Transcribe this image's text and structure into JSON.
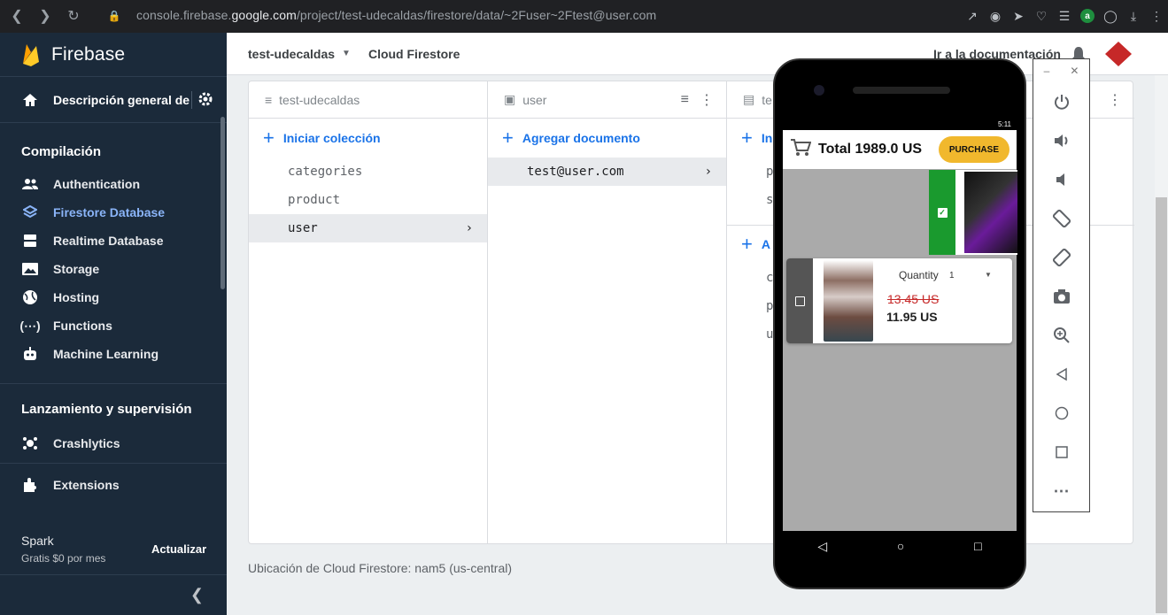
{
  "browser": {
    "url_prefix": "console.firebase.",
    "url_domain": "google.com",
    "url_path": "/project/test-udecaldas/firestore/data/~2Fuser~2Ftest@user.com"
  },
  "sidebar": {
    "brand": "Firebase",
    "overview": "Descripción general de",
    "section_build": "Compilación",
    "items": [
      {
        "label": "Authentication",
        "icon": "people-icon"
      },
      {
        "label": "Firestore Database",
        "icon": "firestore-icon"
      },
      {
        "label": "Realtime Database",
        "icon": "database-icon"
      },
      {
        "label": "Storage",
        "icon": "image-icon"
      },
      {
        "label": "Hosting",
        "icon": "globe-icon"
      },
      {
        "label": "Functions",
        "icon": "functions-icon"
      },
      {
        "label": "Machine Learning",
        "icon": "robot-icon"
      }
    ],
    "section_release": "Lanzamiento y supervisión",
    "crashlytics": "Crashlytics",
    "extensions": "Extensions",
    "plan_name": "Spark",
    "plan_desc": "Gratis $0 por mes",
    "upgrade": "Actualizar"
  },
  "topbar": {
    "project": "test-udecaldas",
    "product": "Cloud Firestore",
    "docs": "Ir a la documentación"
  },
  "firestore": {
    "col1_title": "test-udecaldas",
    "col1_action": "Iniciar colección",
    "collections": [
      "categories",
      "product",
      "user"
    ],
    "col2_title": "user",
    "col2_action": "Agregar documento",
    "documents": [
      "test@user.com"
    ],
    "col3_title": "te",
    "col3_action": "In",
    "col3_fields": [
      "p",
      "s"
    ],
    "col3_action2": "A",
    "col3_fields2": [
      "c",
      "p",
      "u"
    ],
    "location": "Ubicación de Cloud Firestore: nam5 (us-central)"
  },
  "phone": {
    "time": "5:11",
    "total": "Total 1989.0 US",
    "purchase": "PURCHASE",
    "quantity_label": "Quantity",
    "quantity_value": "1",
    "old_price": "13.45 US",
    "new_price": "11.95 US"
  }
}
